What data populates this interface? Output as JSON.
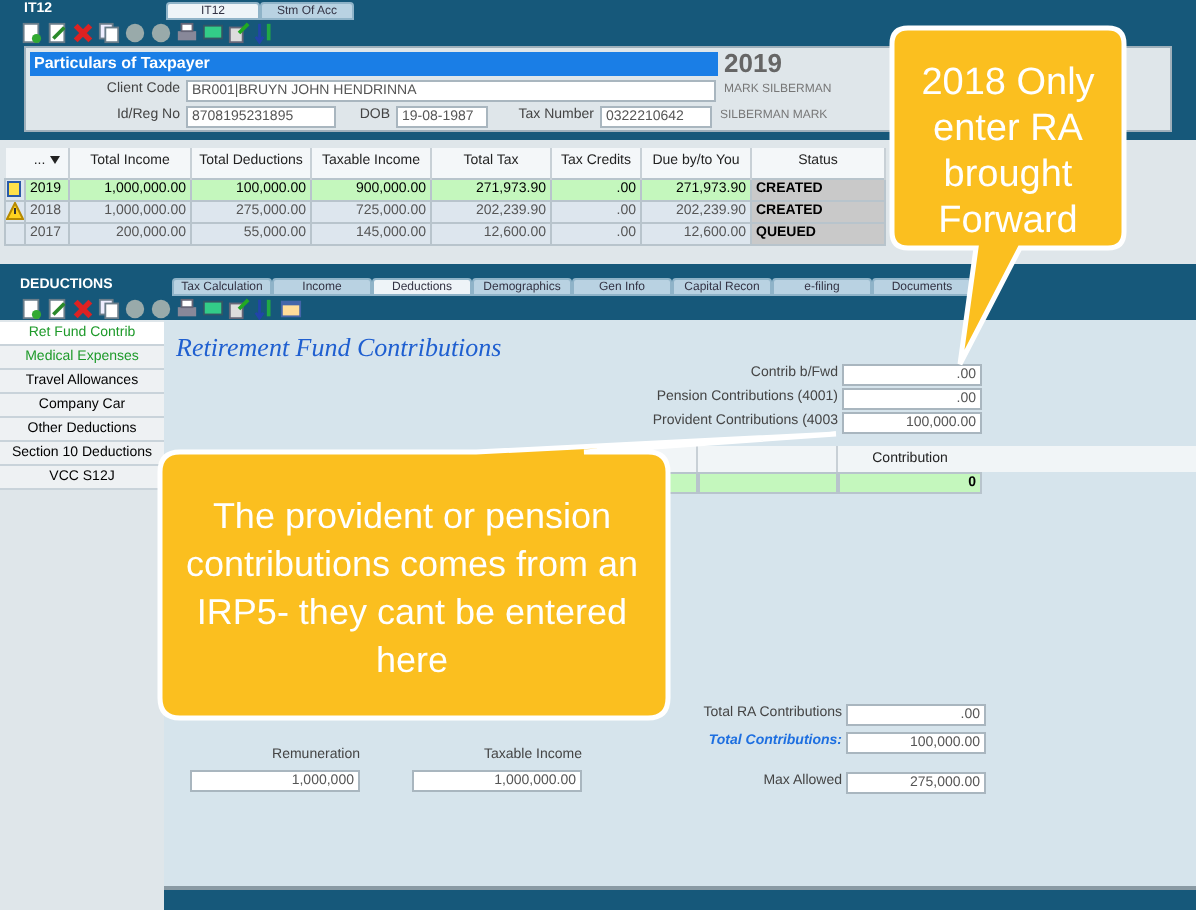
{
  "module": {
    "label": "IT12",
    "tabs": [
      {
        "label": "IT12",
        "selected": true
      },
      {
        "label": "Stm Of Acc",
        "selected": false
      }
    ]
  },
  "taxpayer": {
    "title": "Particulars of Taxpayer",
    "year": "2019",
    "client_code_label": "Client Code",
    "client_code": "BR001|BRUYN JOHN HENDRINNA",
    "id_label": "Id/Reg No",
    "id": "8708195231895",
    "dob_label": "DOB",
    "dob": "19-08-1987",
    "tax_number_label": "Tax Number",
    "tax_number": "0322210642",
    "name_1": "MARK SILBERMAN",
    "name_2": "SILBERMAN MARK"
  },
  "years_table": {
    "columns": [
      "...",
      "Total Income",
      "Total Deductions",
      "Taxable Income",
      "Total Tax",
      "Tax Credits",
      "Due by/to You",
      "Status"
    ],
    "rows": [
      {
        "kind": "note",
        "selected": true,
        "cells": [
          "2019",
          "1,000,000.00",
          "100,000.00",
          "900,000.00",
          "271,973.90",
          ".00",
          "271,973.90",
          "CREATED"
        ]
      },
      {
        "kind": "warning",
        "selected": false,
        "cells": [
          "2018",
          "1,000,000.00",
          "275,000.00",
          "725,000.00",
          "202,239.90",
          ".00",
          "202,239.90",
          "CREATED"
        ]
      },
      {
        "kind": "plain",
        "selected": false,
        "cells": [
          "2017",
          "200,000.00",
          "55,000.00",
          "145,000.00",
          "12,600.00",
          ".00",
          "12,600.00",
          "QUEUED"
        ]
      }
    ]
  },
  "deductions": {
    "label": "DEDUCTIONS",
    "tabs": [
      {
        "label": "Tax Calculation",
        "selected": false
      },
      {
        "label": "Income",
        "selected": false
      },
      {
        "label": "Deductions",
        "selected": true
      },
      {
        "label": "Demographics",
        "selected": false
      },
      {
        "label": "Gen Info",
        "selected": false
      },
      {
        "label": "Capital Recon",
        "selected": false
      },
      {
        "label": "e-filing",
        "selected": false
      },
      {
        "label": "Documents",
        "selected": false
      }
    ],
    "sidebar": [
      {
        "label": "Ret Fund Contrib",
        "selected": true,
        "has_data": true
      },
      {
        "label": "Medical Expenses",
        "selected": false,
        "has_data": true
      },
      {
        "label": "Travel Allowances",
        "selected": false,
        "has_data": false
      },
      {
        "label": "Company Car",
        "selected": false,
        "has_data": false
      },
      {
        "label": "Other Deductions",
        "selected": false,
        "has_data": false
      },
      {
        "label": "Section 10  Deductions",
        "selected": false,
        "has_data": false
      },
      {
        "label": "VCC S12J",
        "selected": false,
        "has_data": false
      }
    ]
  },
  "form": {
    "title": "Retirement Fund Contributions",
    "fields": [
      {
        "label": "Contrib b/Fwd",
        "value": ".00"
      },
      {
        "label": "Pension Contributions (4001)",
        "value": ".00"
      },
      {
        "label": "Provident Contributions (4003",
        "value": "100,000.00"
      }
    ],
    "grid": {
      "columns": [
        "Contribution"
      ],
      "rows": [
        {
          "cells": [
            "0"
          ]
        }
      ]
    },
    "totals": [
      {
        "kind": "plain",
        "label": "Total RA Contributions",
        "value": ".00"
      },
      {
        "kind": "emphasis",
        "label": "Total Contributions:",
        "value": "100,000.00"
      },
      {
        "kind": "gap",
        "label": "Max Allowed",
        "value": "275,000.00"
      }
    ],
    "income": [
      {
        "label": "Remuneration",
        "value": "1,000,000"
      },
      {
        "label": "Taxable Income",
        "value": "1,000,000.00"
      }
    ]
  },
  "callouts": [
    {
      "kind": "down",
      "text": "2018 Only enter RA brought Forward"
    },
    {
      "kind": "up-right",
      "text": "The provident or pension contributions comes from an IRP5- they cant be entered here"
    }
  ]
}
